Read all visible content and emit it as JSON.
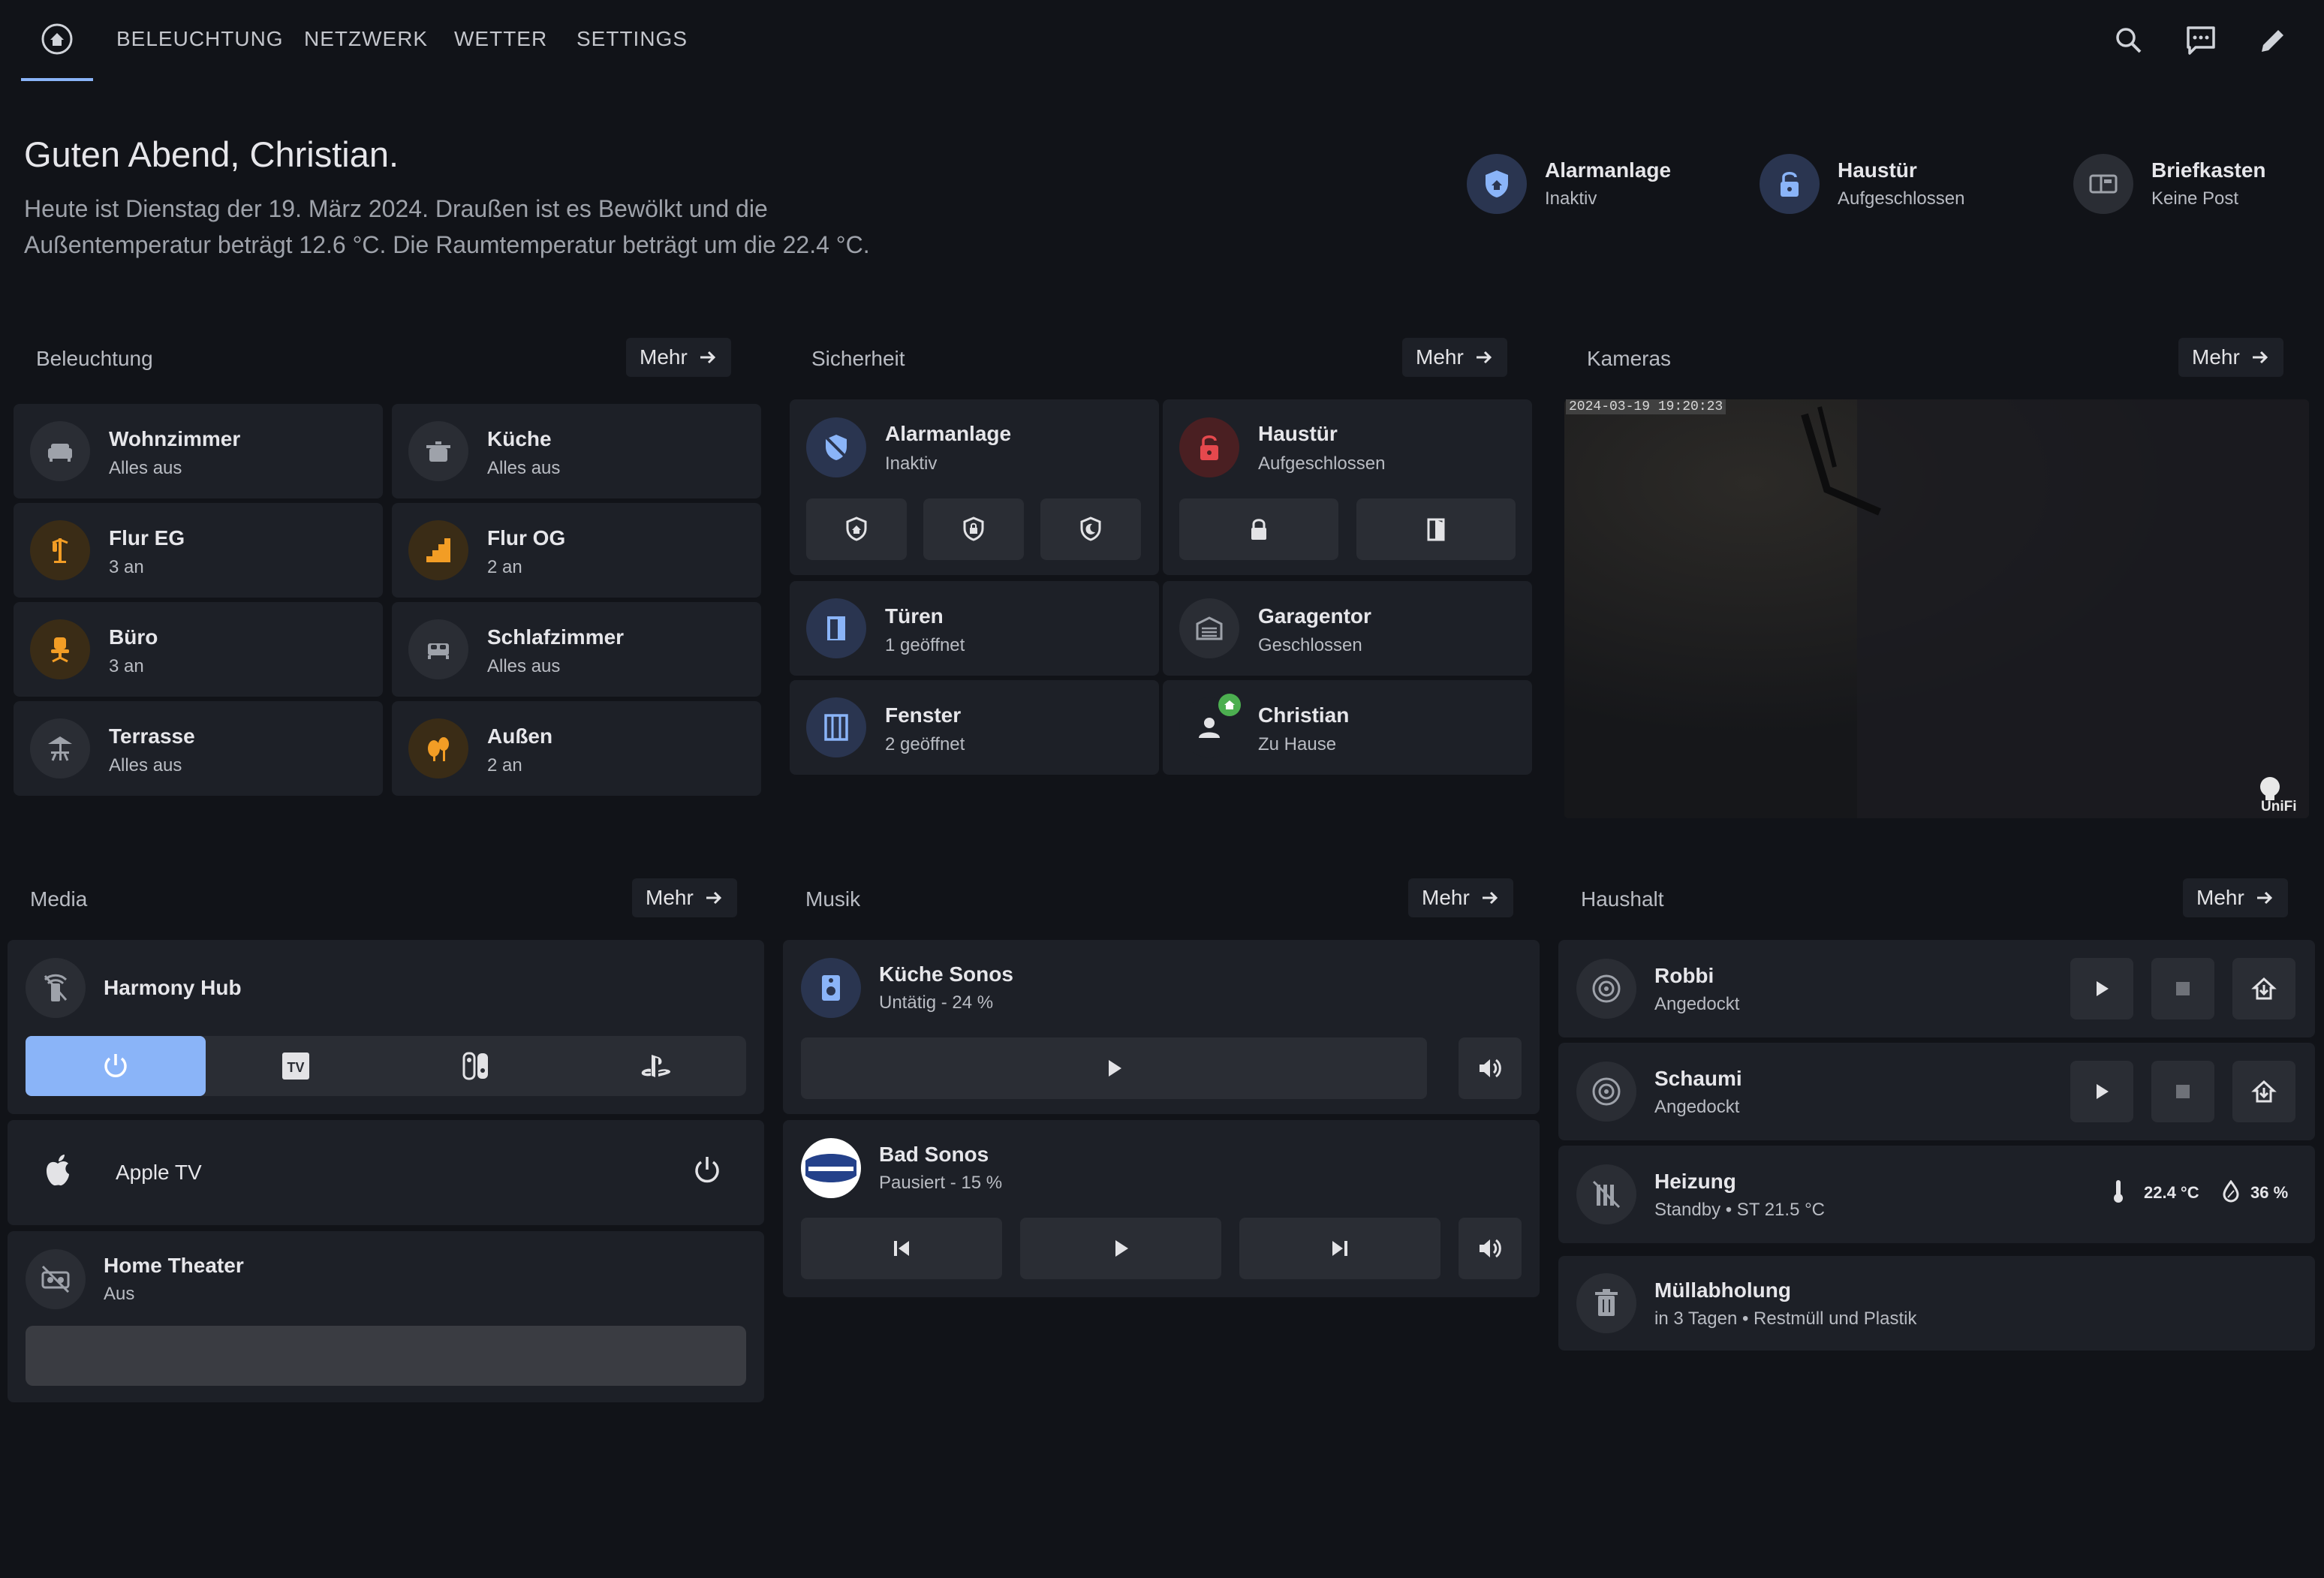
{
  "nav": {
    "tabs": [
      "BELEUCHTUNG",
      "NETZWERK",
      "WETTER",
      "SETTINGS"
    ]
  },
  "greeting": {
    "title": "Guten Abend, Christian.",
    "line1": "Heute ist Dienstag der 19. März 2024. Draußen ist es Bewölkt und die",
    "line2": "Außentemperatur beträgt 12.6 °C. Die Raumtemperatur beträgt um die 22.4 °C."
  },
  "badges": [
    {
      "name": "Alarmanlage",
      "state": "Inaktiv"
    },
    {
      "name": "Haustür",
      "state": "Aufgeschlossen"
    },
    {
      "name": "Briefkasten",
      "state": "Keine Post"
    }
  ],
  "more_label": "Mehr",
  "sections": {
    "lighting": "Beleuchtung",
    "security": "Sicherheit",
    "cameras": "Kameras",
    "media": "Media",
    "music": "Musik",
    "household": "Haushalt"
  },
  "lights": [
    {
      "name": "Wohnzimmer",
      "state": "Alles aus",
      "icon": "sofa-icon"
    },
    {
      "name": "Küche",
      "state": "Alles aus",
      "icon": "pot-icon"
    },
    {
      "name": "Flur EG",
      "state": "3 an",
      "icon": "coat-rack-icon"
    },
    {
      "name": "Flur OG",
      "state": "2 an",
      "icon": "stairs-icon"
    },
    {
      "name": "Büro",
      "state": "3 an",
      "icon": "office-chair-icon"
    },
    {
      "name": "Schlafzimmer",
      "state": "Alles aus",
      "icon": "bed-icon"
    },
    {
      "name": "Terrasse",
      "state": "Alles aus",
      "icon": "umbrella-table-icon"
    },
    {
      "name": "Außen",
      "state": "2 an",
      "icon": "tree-icon"
    }
  ],
  "security": {
    "alarm": {
      "name": "Alarmanlage",
      "state": "Inaktiv"
    },
    "door": {
      "name": "Haustür",
      "state": "Aufgeschlossen"
    },
    "doors": {
      "name": "Türen",
      "state": "1 geöffnet"
    },
    "garage": {
      "name": "Garagentor",
      "state": "Geschlossen"
    },
    "windows": {
      "name": "Fenster",
      "state": "2 geöffnet"
    },
    "person": {
      "name": "Christian",
      "state": "Zu Hause"
    }
  },
  "camera": {
    "timestamp": "2024-03-19 19:20:23",
    "logo": "UniFi"
  },
  "media": {
    "harmony": "Harmony Hub",
    "apple_tv": "Apple TV",
    "home_theater": {
      "name": "Home Theater",
      "state": "Aus"
    }
  },
  "music": [
    {
      "name": "Küche Sonos",
      "state": "Untätig - 24 %"
    },
    {
      "name": "Bad Sonos",
      "state": "Pausiert - 15 %"
    }
  ],
  "household": {
    "robbi": {
      "name": "Robbi",
      "state": "Angedockt"
    },
    "schaumi": {
      "name": "Schaumi",
      "state": "Angedockt"
    },
    "heating": {
      "name": "Heizung",
      "state": "Standby • ST 21.5 °C",
      "temperature": "22.4 °C",
      "humidity": "36 %"
    },
    "trash": {
      "name": "Müllabholung",
      "state": "in 3 Tagen • Restmüll und Plastik"
    }
  },
  "colors": {
    "accent": "#8ab4f8",
    "orange": "#f29d25",
    "red": "#e5484d",
    "green": "#4caf50",
    "background": "#111318",
    "card": "#1d2027"
  }
}
